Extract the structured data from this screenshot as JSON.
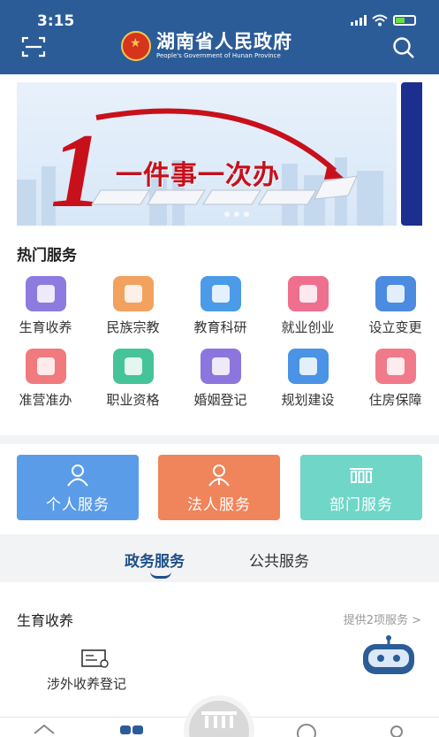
{
  "status": {
    "time": "3:15"
  },
  "header": {
    "title": "湖南省人民政府",
    "subtitle": "People's Government of Hunan Province",
    "scan_icon": "scan-icon",
    "search_icon": "search-icon"
  },
  "banner": {
    "headline": "一件事一次办",
    "numeral": "1"
  },
  "hot_services": {
    "title": "热门服务",
    "items": [
      {
        "label": "生育收养",
        "color": "#8e7be0"
      },
      {
        "label": "民族宗教",
        "color": "#f2a25e"
      },
      {
        "label": "教育科研",
        "color": "#4b9be8"
      },
      {
        "label": "就业创业",
        "color": "#ef6f8e"
      },
      {
        "label": "设立变更",
        "color": "#4b8be0"
      },
      {
        "label": "准营准办",
        "color": "#f07a7e"
      },
      {
        "label": "职业资格",
        "color": "#45c49a"
      },
      {
        "label": "婚姻登记",
        "color": "#8c76de"
      },
      {
        "label": "规划建设",
        "color": "#4a93e6"
      },
      {
        "label": "住房保障",
        "color": "#f07a8a"
      }
    ]
  },
  "service_cards": [
    {
      "label": "个人服务",
      "color": "#5b9ce8",
      "icon": "person-icon"
    },
    {
      "label": "法人服务",
      "color": "#f0845a",
      "icon": "legal-person-icon"
    },
    {
      "label": "部门服务",
      "color": "#6fd6c8",
      "icon": "department-icon"
    }
  ],
  "tabs": {
    "active": "政务服务",
    "other": "公共服务"
  },
  "category": {
    "title": "生育收养",
    "more": "提供2项服务 >",
    "item_label": "涉外收养登记"
  }
}
